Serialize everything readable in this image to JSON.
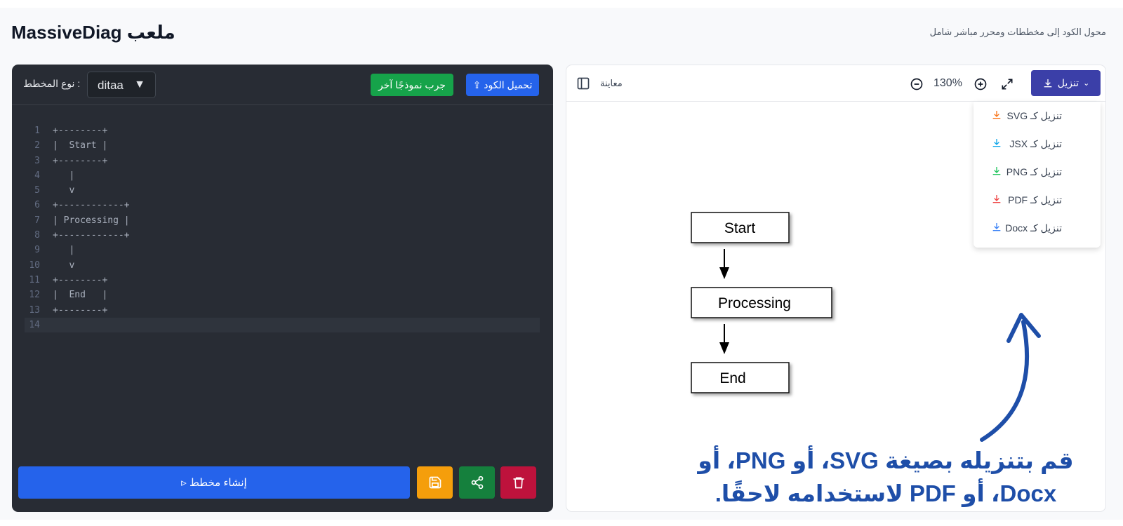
{
  "header": {
    "title": "ملعب MassiveDiag",
    "subtitle": "محول الكود إلى مخططات ومحرر مباشر شامل"
  },
  "editor": {
    "diagram_type_label": ": نوع المخطط",
    "diagram_type_value": "ditaa",
    "try_button": "جرب نموذجًا آخر",
    "upload_button": "تحميل الكود ⇪",
    "generate_button": "إنشاء مخطط ▹",
    "code_lines": [
      "+--------+",
      "|  Start |",
      "+--------+",
      "   |",
      "   v",
      "+------------+",
      "| Processing |",
      "+------------+",
      "   |",
      "   v",
      "+--------+",
      "|  End   |",
      "+--------+",
      ""
    ],
    "line_numbers": [
      "1",
      "2",
      "3",
      "4",
      "5",
      "6",
      "7",
      "8",
      "9",
      "10",
      "11",
      "12",
      "13",
      "14"
    ]
  },
  "preview": {
    "label": "معاينة",
    "zoom": "130%",
    "download_button": "تنزيل",
    "menu": [
      {
        "label": "تنزيل كـ SVG",
        "color": "#f97316"
      },
      {
        "label": "تنزيل كـ JSX",
        "color": "#0ea5e9"
      },
      {
        "label": "تنزيل كـ PNG",
        "color": "#22c55e"
      },
      {
        "label": "تنزيل كـ PDF",
        "color": "#ef4444"
      },
      {
        "label": "تنزيل كـ Docx",
        "color": "#3b82f6"
      }
    ],
    "diagram_nodes": [
      "Start",
      "Processing",
      "End"
    ]
  },
  "annotation": {
    "line1": "قم بتنزيله بصيغة SVG، أو PNG، أو",
    "line2": "Docx، أو PDF لاستخدامه لاحقًا."
  },
  "colors": {
    "primary": "#2563eb",
    "success": "#16a34a",
    "download": "#3b3fa8",
    "annotation": "#1e4ea8"
  }
}
